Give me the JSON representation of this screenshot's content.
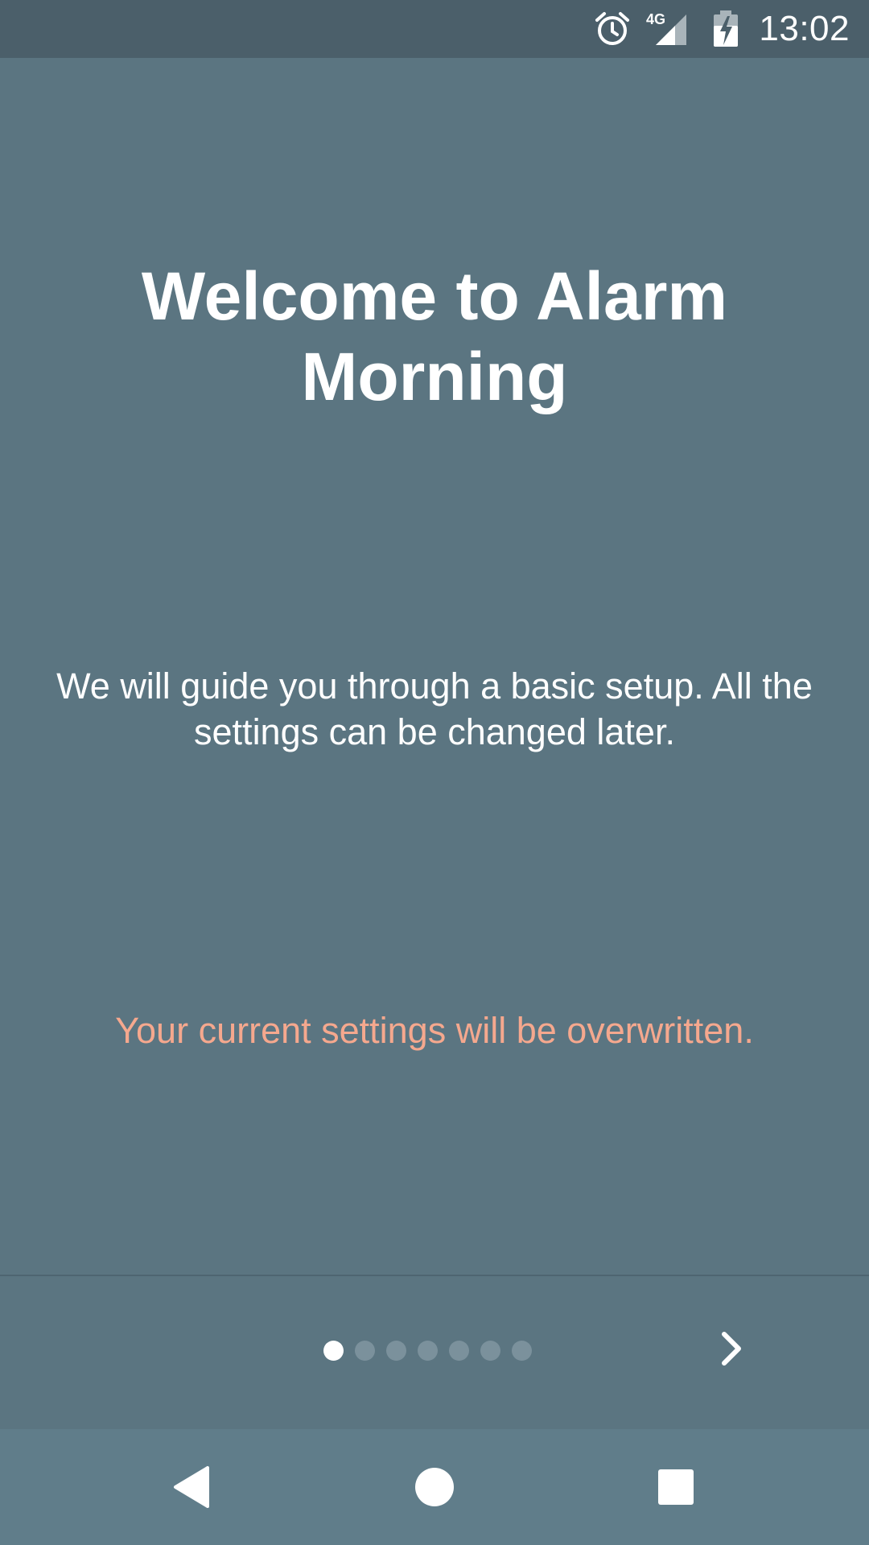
{
  "status_bar": {
    "time": "13:02",
    "icons": [
      "alarm-icon",
      "signal-4g-icon",
      "battery-charging-icon"
    ],
    "network_label": "4G"
  },
  "onboarding": {
    "title": "Welcome to Alarm Morning",
    "subtitle": "We will guide you through a basic setup. All the settings can be changed later.",
    "warning": "Your current settings will be overwritten."
  },
  "pager": {
    "page_count": 7,
    "current_page": 1,
    "next_icon": "chevron-right-icon"
  },
  "nav_bar": {
    "icons": [
      "back-icon",
      "home-icon",
      "recents-icon"
    ]
  },
  "colors": {
    "background": "#5b7581",
    "status_bar": "#4b5f6a",
    "nav_bar": "#607d8a",
    "warning_text": "#f5a88e",
    "text": "#ffffff"
  }
}
